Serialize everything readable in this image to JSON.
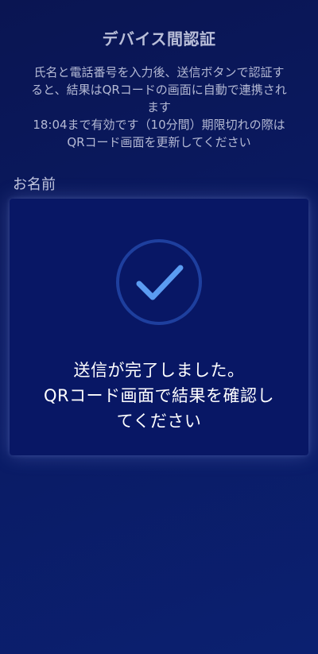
{
  "page": {
    "title": "デバイス間認証"
  },
  "instructions": {
    "line1": "氏名と電話番号を入力後、送信ボタンで認証す",
    "line2": "ると、結果はQRコードの画面に自動で連携され",
    "line3": "ます",
    "line4": "18:04まで有効です（10分間）期限切れの際は",
    "line5": "QRコード画面を更新してください"
  },
  "form": {
    "name_label": "お名前"
  },
  "modal": {
    "icon": "check-circle-icon",
    "message_line1": "送信が完了しました。",
    "message_line2": "QRコード画面で結果を確認し",
    "message_line3": "てください"
  },
  "colors": {
    "background": "#0a1a62",
    "modal_background": "#081765",
    "check_stroke": "#5b9cf2",
    "check_ring": "#1e3f9e"
  }
}
